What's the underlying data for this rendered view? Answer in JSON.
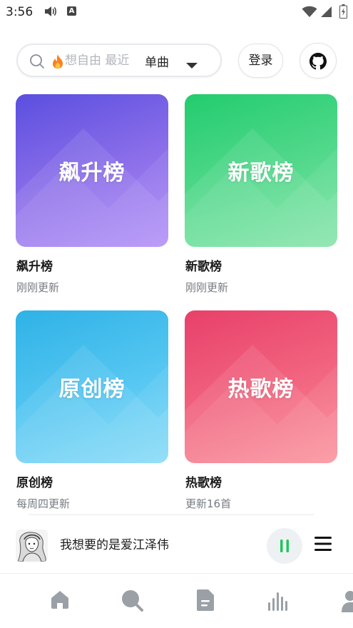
{
  "status_bar": {
    "time": "3:56",
    "input_indicator": "A"
  },
  "search": {
    "placeholder": "想自由 最近",
    "type_label": "单曲"
  },
  "header": {
    "login_label": "登录"
  },
  "charts": [
    {
      "cover_text": "飙升榜",
      "title": "飙升榜",
      "update": "刚刚更新"
    },
    {
      "cover_text": "新歌榜",
      "title": "新歌榜",
      "update": "刚刚更新"
    },
    {
      "cover_text": "原创榜",
      "title": "原创榜",
      "update": "每周四更新"
    },
    {
      "cover_text": "热歌榜",
      "title": "热歌榜",
      "update": "更新16首"
    }
  ],
  "player": {
    "song_title": "我想要的是爱江泽伟"
  },
  "colors": {
    "accent_green": "#22c55e",
    "soaring": "#5b4fdf",
    "new": "#22cc6e",
    "original": "#2fb2e6",
    "hot": "#e8406a",
    "nav_icon": "#9aa0a6"
  },
  "icons": {
    "status": [
      "volume-icon",
      "input-method-icon",
      "wifi-icon",
      "signal-icon",
      "battery-icon"
    ],
    "search": [
      "search-icon",
      "fire-icon",
      "chevron-down-icon"
    ],
    "header": [
      "github-icon"
    ],
    "player": [
      "pause-icon",
      "playlist-icon"
    ],
    "nav": [
      "home-icon",
      "search-icon",
      "document-icon",
      "chart-icon",
      "user-icon"
    ]
  }
}
